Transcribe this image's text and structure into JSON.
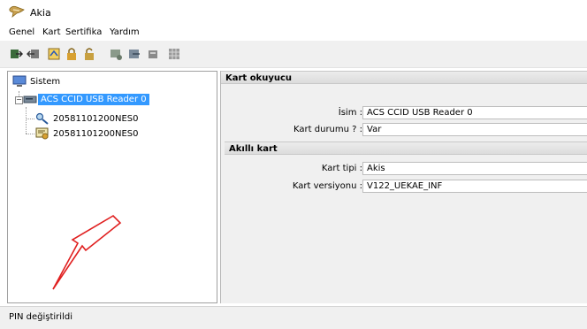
{
  "window": {
    "title": "Akia"
  },
  "menu": [
    "Genel",
    "Kart",
    "Sertifika",
    "Yardım"
  ],
  "toolbar": {
    "buttons": [
      "login-icon",
      "logout-icon",
      "sign-document-icon",
      "lock-icon",
      "unlock-icon",
      "certificate-icon",
      "export-icon",
      "key-icon",
      "grid-icon"
    ]
  },
  "tree": {
    "root": "Sistem",
    "reader": "ACS CCID USB Reader 0",
    "children": [
      "20581101200NES0",
      "20581101200NES0"
    ]
  },
  "reader_section": {
    "title": "Kart okuyucu",
    "name_label": "İsim :",
    "name_value": "ACS CCID USB Reader 0",
    "status_label": "Kart durumu ? :",
    "status_value": "Var"
  },
  "card_section": {
    "title": "Akıllı kart",
    "type_label": "Kart tipi :",
    "type_value": "Akis",
    "version_label": "Kart versiyonu :",
    "version_value": "V122_UEKAE_INF"
  },
  "status": {
    "text": "PIN değiştirildi"
  },
  "colors": {
    "selection": "#3399ff",
    "annotation_arrow": "#e02020"
  }
}
